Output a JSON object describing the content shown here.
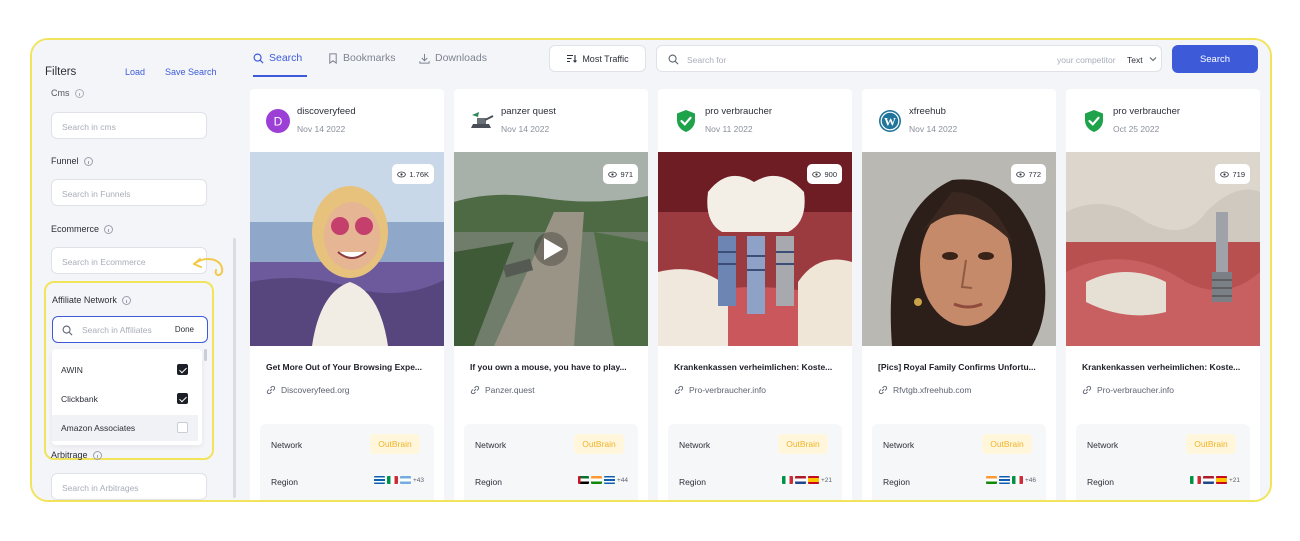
{
  "sidebar": {
    "title": "Filters",
    "load_label": "Load",
    "save_search_label": "Save Search",
    "cms": {
      "label": "Cms",
      "placeholder": "Search in cms"
    },
    "funnel": {
      "label": "Funnel",
      "placeholder": "Search in Funnels"
    },
    "ecommerce": {
      "label": "Ecommerce",
      "placeholder": "Search in Ecommerce"
    },
    "affiliate": {
      "label": "Affiliate Network",
      "placeholder": "Search in Affiliates",
      "done_label": "Done",
      "options": [
        {
          "label": "AWIN",
          "checked": true
        },
        {
          "label": "Clickbank",
          "checked": true
        },
        {
          "label": "Amazon Associates",
          "checked": false
        }
      ]
    },
    "arbitrage": {
      "label": "Arbitrage",
      "placeholder": "Search in Arbitrages"
    }
  },
  "topbar": {
    "tabs": [
      {
        "label": "Search",
        "active": true,
        "icon": "search-icon"
      },
      {
        "label": "Bookmarks",
        "active": false,
        "icon": "bookmark-icon"
      },
      {
        "label": "Downloads",
        "active": false,
        "icon": "download-icon"
      }
    ],
    "sort_label": "Most Traffic",
    "search_placeholder": "Search for",
    "search_hint": "your competitor",
    "search_type": "Text",
    "search_button": "Search"
  },
  "cards": [
    {
      "name": "discoveryfeed",
      "date": "Nov 14 2022",
      "views": "1.76K",
      "title": "Get More Out of Your Browsing Expe...",
      "domain": "Discoveryfeed.org",
      "network_label": "Network",
      "network": "OutBrain",
      "region_label": "Region",
      "more": "+43",
      "avatar": "letter-d",
      "avatar_letter": "D",
      "flags": [
        "gr",
        "it",
        "ar"
      ]
    },
    {
      "name": "panzer quest",
      "date": "Nov 14 2022",
      "views": "971",
      "title": "If you own a mouse, you have to play...",
      "domain": "Panzer.quest",
      "network_label": "Network",
      "network": "OutBrain",
      "region_label": "Region",
      "more": "+44",
      "avatar": "tank-logo",
      "flags": [
        "ae",
        "in",
        "gr"
      ]
    },
    {
      "name": "pro verbraucher",
      "date": "Nov 11 2022",
      "views": "900",
      "title": "Krankenkassen verheimlichen: Koste...",
      "domain": "Pro-verbraucher.info",
      "network_label": "Network",
      "network": "OutBrain",
      "region_label": "Region",
      "more": "+21",
      "avatar": "shield-check-icon",
      "flags": [
        "it",
        "nl",
        "es"
      ]
    },
    {
      "name": "xfreehub",
      "date": "Nov 14 2022",
      "views": "772",
      "title": "[Pics] Royal Family Confirms Unfortu...",
      "domain": "Rfvtgb.xfreehub.com",
      "network_label": "Network",
      "network": "OutBrain",
      "region_label": "Region",
      "more": "+46",
      "avatar": "wordpress-icon",
      "flags": [
        "in",
        "gr",
        "it"
      ]
    },
    {
      "name": "pro verbraucher",
      "date": "Oct 25 2022",
      "views": "719",
      "title": "Krankenkassen verheimlichen: Koste...",
      "domain": "Pro-verbraucher.info",
      "network_label": "Network",
      "network": "OutBrain",
      "region_label": "Region",
      "more": "+21",
      "avatar": "shield-check-icon",
      "flags": [
        "it",
        "nl",
        "es"
      ]
    }
  ],
  "colors": {
    "accent": "#3d5bd9",
    "highlight": "#f2e45a",
    "badge_text": "#f0b429",
    "badge_bg": "#fff6dc"
  }
}
